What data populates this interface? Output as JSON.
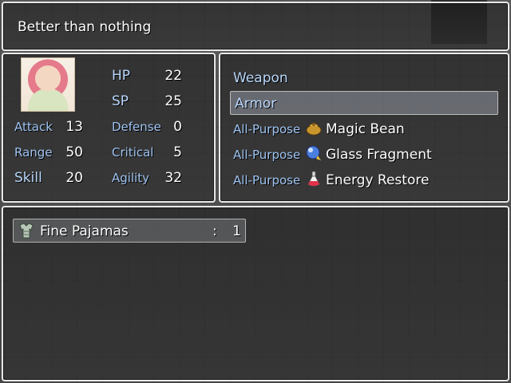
{
  "help": {
    "text": "Better than nothing"
  },
  "status": {
    "attack": {
      "label": "Attack",
      "value": "13"
    },
    "range": {
      "label": "Range",
      "value": "50"
    },
    "skill": {
      "label": "Skill",
      "value": "20"
    },
    "hp": {
      "label": "HP",
      "value": "22"
    },
    "sp": {
      "label": "SP",
      "value": "25"
    },
    "defense": {
      "label": "Defense",
      "value": "0"
    },
    "critical": {
      "label": "Critical",
      "value": "5"
    },
    "agility": {
      "label": "Agility",
      "value": "32"
    }
  },
  "categories": [
    {
      "label": "Weapon"
    },
    {
      "label": "Armor"
    }
  ],
  "items": [
    {
      "category": "All-Purpose",
      "icon": "bag-icon",
      "name": "Magic Bean"
    },
    {
      "category": "All-Purpose",
      "icon": "orb-icon",
      "name": "Glass Fragment"
    },
    {
      "category": "All-Purpose",
      "icon": "potion-icon",
      "name": "Energy Restore"
    }
  ],
  "equipment": [
    {
      "icon": "pajamas-icon",
      "name": "Fine Pajamas",
      "separator": ":",
      "count": "1"
    }
  ],
  "colors": {
    "system_text": "#9fc4f2",
    "normal_text": "#ffffff",
    "window_border": "#e8e8e8"
  }
}
